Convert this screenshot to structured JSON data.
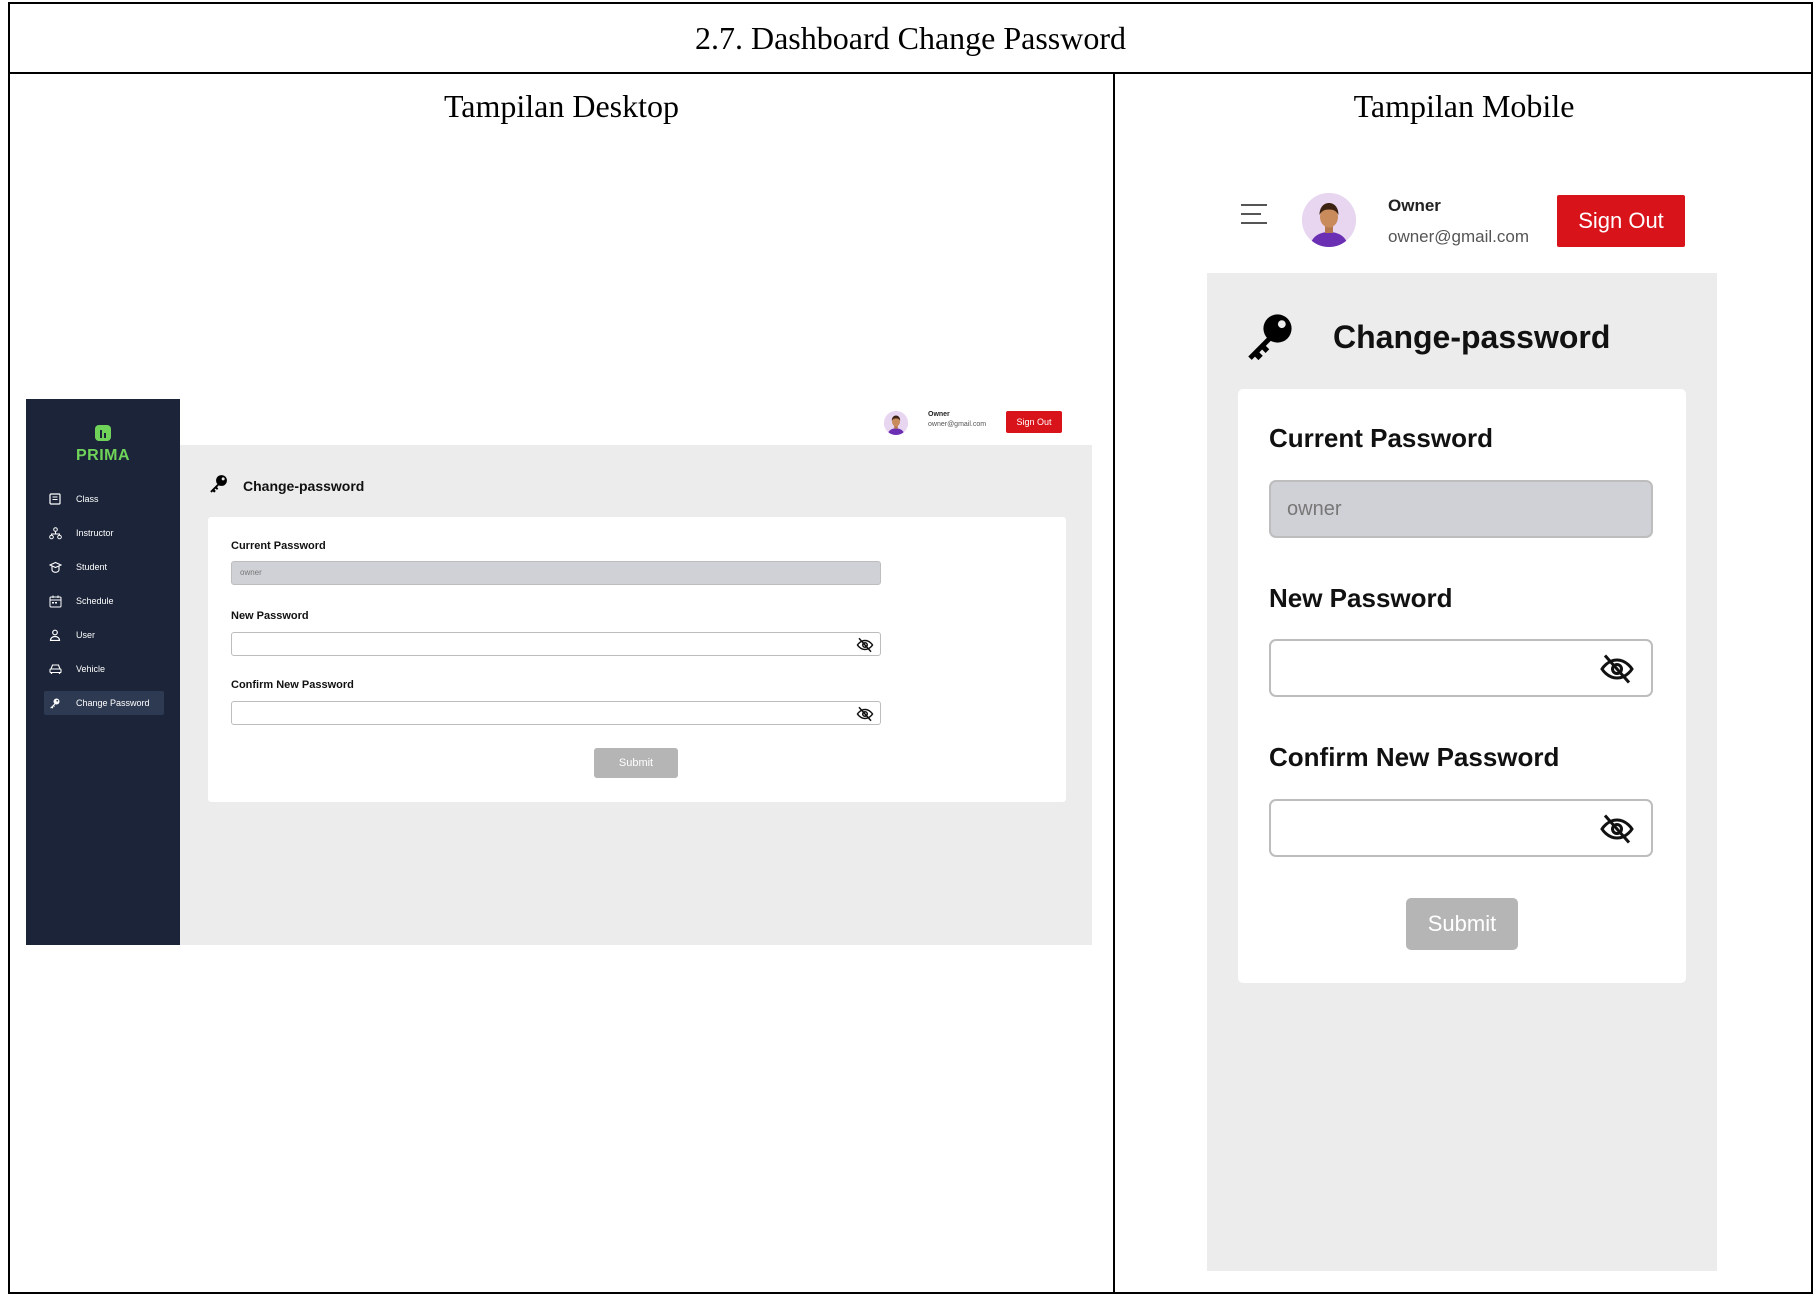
{
  "document": {
    "title": "2.7. Dashboard Change Password",
    "desktop_heading": "Tampilan Desktop",
    "mobile_heading": "Tampilan Mobile"
  },
  "app": {
    "brand": "PRIMA",
    "brand_color": "#6fd35a",
    "sidebar_bg": "#1b2438",
    "signout_color": "#d8141a"
  },
  "sidebar": {
    "items": [
      {
        "label": "Class",
        "icon": "class-icon"
      },
      {
        "label": "Instructor",
        "icon": "instructor-icon"
      },
      {
        "label": "Student",
        "icon": "student-icon"
      },
      {
        "label": "Schedule",
        "icon": "schedule-icon"
      },
      {
        "label": "User",
        "icon": "user-icon"
      },
      {
        "label": "Vehicle",
        "icon": "vehicle-icon"
      },
      {
        "label": "Change Password",
        "icon": "key-icon",
        "active": true
      }
    ]
  },
  "user": {
    "name": "Owner",
    "email": "owner@gmail.com",
    "signout_label": "Sign Out"
  },
  "page": {
    "title": "Change-password"
  },
  "form": {
    "current_password_label": "Current Password",
    "current_password_value": "owner",
    "new_password_label": "New Password",
    "new_password_value": "",
    "confirm_password_label": "Confirm New Password",
    "confirm_password_value": "",
    "submit_label": "Submit"
  }
}
